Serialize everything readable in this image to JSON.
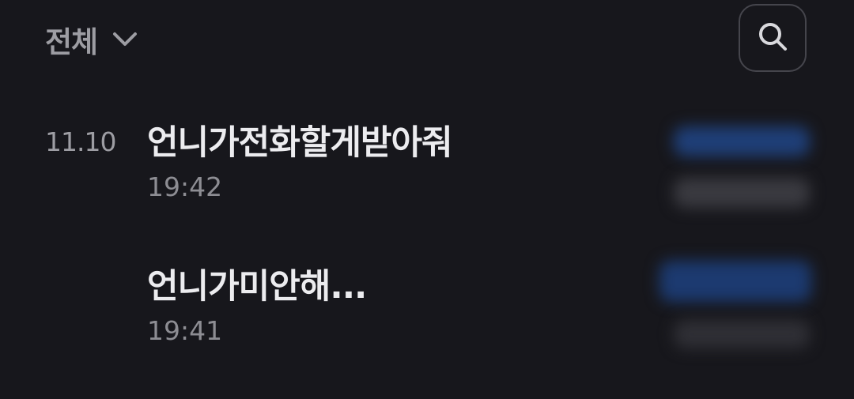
{
  "header": {
    "filter_label": "전체",
    "filter_icon": "chevron-down-icon",
    "search_icon": "search-icon"
  },
  "list": {
    "date": "11.10",
    "items": [
      {
        "title": "언니가전화할게받아줘",
        "time": "19:42"
      },
      {
        "title": "언니가미안해...",
        "time": "19:41"
      }
    ]
  },
  "colors": {
    "background": "#17171c",
    "primary_text": "#ececef",
    "secondary_text": "#9d9da3",
    "blurred_accent": "#1f3f78"
  }
}
